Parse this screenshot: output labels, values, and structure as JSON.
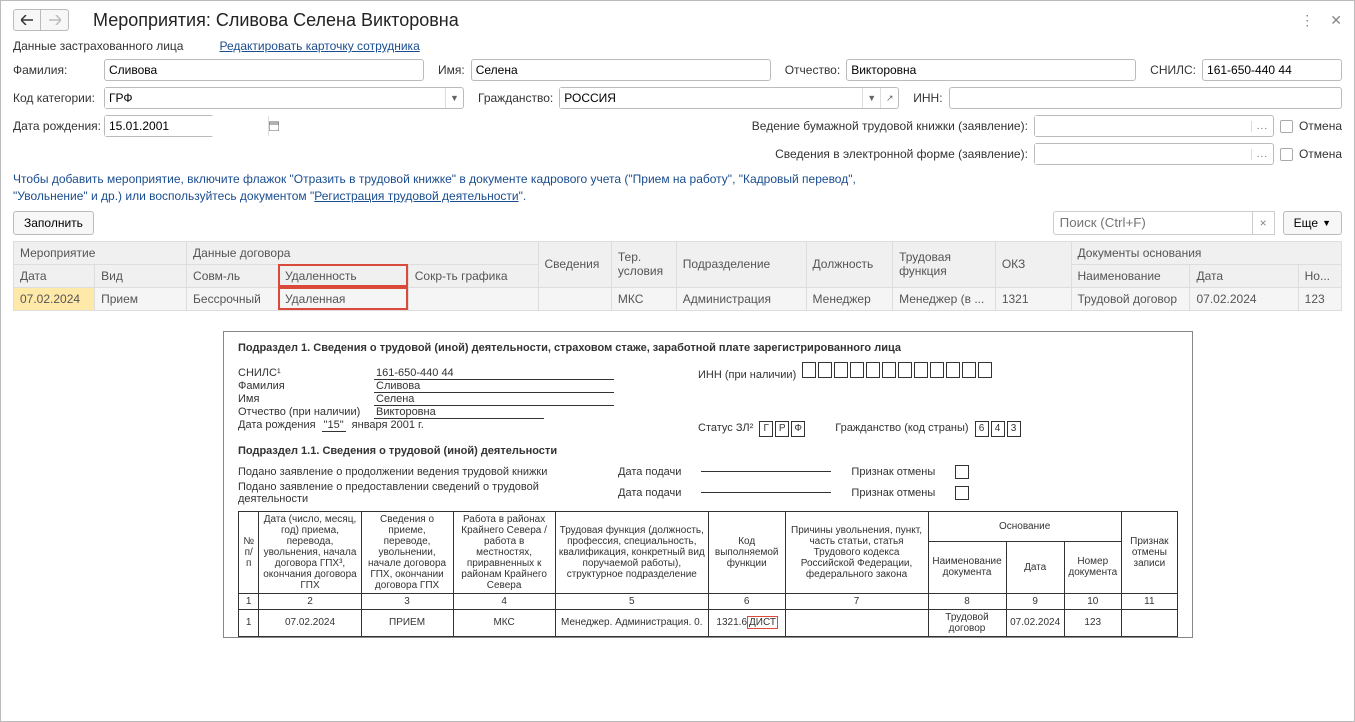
{
  "header": {
    "title": "Мероприятия: Сливова Селена Викторовна"
  },
  "insured": {
    "section_label": "Данные застрахованного лица",
    "edit_link": "Редактировать карточку сотрудника",
    "surname_label": "Фамилия:",
    "surname": "Сливова",
    "name_label": "Имя:",
    "name": "Селена",
    "patronymic_label": "Отчество:",
    "patronymic": "Викторовна",
    "snils_label": "СНИЛС:",
    "snils": "161-650-440 44",
    "category_label": "Код категории:",
    "category": "ГРФ",
    "citizenship_label": "Гражданство:",
    "citizenship": "РОССИЯ",
    "inn_label": "ИНН:",
    "inn": "",
    "dob_label": "Дата рождения:",
    "dob": "15.01.2001",
    "paper_book_label": "Ведение бумажной трудовой книжки (заявление):",
    "paper_book_cancel": "Отмена",
    "electronic_label": "Сведения в электронной форме (заявление):",
    "electronic_cancel": "Отмена"
  },
  "hint": {
    "line1": "Чтобы добавить мероприятие, включите флажок \"Отразить в трудовой книжке\" в документе кадрового учета (\"Прием на работу\", \"Кадровый перевод\",",
    "line2_start": "\"Увольнение\" и др.) или воспользуйтесь документом \"",
    "line2_link": "Регистрация трудовой деятельности",
    "line2_end": "\"."
  },
  "toolbar": {
    "fill_btn": "Заполнить",
    "search_placeholder": "Поиск (Ctrl+F)",
    "more_btn": "Еще"
  },
  "grid": {
    "h_event": "Мероприятие",
    "h_contract": "Данные договора",
    "h_sved": "Сведения",
    "h_ter": "Тер. условия",
    "h_podr": "Подразделение",
    "h_dolzh": "Должность",
    "h_trud": "Трудовая функция",
    "h_okz": "ОКЗ",
    "h_docs": "Документы основания",
    "h_date": "Дата",
    "h_vid": "Вид",
    "h_sovm": "Совм-ль",
    "h_udal": "Удаленность",
    "h_sokr": "Сокр-ть графика",
    "h_naim": "Наименование",
    "h_ddate": "Дата",
    "h_no": "Но...",
    "row": {
      "date": "07.02.2024",
      "vid": "Прием",
      "sovm": "Бессрочный",
      "udal": "Удаленная",
      "sokr": "",
      "sved": "",
      "ter": "МКС",
      "podr": "Администрация",
      "dolzh": "Менеджер",
      "trud": "Менеджер (в ...",
      "okz": "1321",
      "naim": "Трудовой договор",
      "ddate": "07.02.2024",
      "no": "123"
    }
  },
  "report": {
    "title": "Подраздел 1. Сведения о трудовой (иной) деятельности, страховом стаже, заработной плате зарегистрированного лица",
    "snils_label": "СНИЛС¹",
    "snils": "161-650-440 44",
    "inn_label": "ИНН (при наличии)",
    "surname_label": "Фамилия",
    "surname": "Сливова",
    "name_label": "Имя",
    "name": "Селена",
    "patronymic_label": "Отчество (при наличии)",
    "patronymic": "Викторовна",
    "dob_label_pre": "Дата рождения ",
    "dob_day_q": "\"15\"",
    "dob_rest": " января 2001 г.",
    "status_label": "Статус ЗЛ²",
    "status_g": "Г",
    "status_r": "Р",
    "status_f": "Ф",
    "citizenship_label": "Гражданство (код страны)",
    "cz_6": "6",
    "cz_4": "4",
    "cz_3": "3",
    "subtitle": "Подраздел 1.1. Сведения о трудовой (иной) деятельности",
    "cont_paper": "Подано заявление о продолжении ведения трудовой книжки",
    "electronic_info": "Подано заявление о предоставлении сведений о трудовой деятельности",
    "date_submit": "Дата подачи",
    "cancel_flag": "Признак отмены",
    "th_np": "№ п/п",
    "th_date": "Дата (число, месяц, год) приема, перевода, увольнения, начала договора ГПХ³, окончания договора ГПХ",
    "th_sved": "Сведения о приеме, переводе, увольнении, начале договора ГПХ, окончании договора ГПХ",
    "th_north": "Работа в районах Крайнего Севера / работа в местностях, приравненных к районам Крайнего Севера",
    "th_func": "Трудовая функция (должность, профессия, специальность, квалификация, конкретный вид поручаемой работы), структурное подразделение",
    "th_code": "Код выполняемой функции",
    "th_reason": "Причины увольнения, пункт, часть статьи, статья Трудового кодекса Российской Федерации, федерального закона",
    "th_basis": "Основание",
    "th_cancelflag": "Признак отмены записи",
    "th_docname": "Наименование документа",
    "th_docdate": "Дата",
    "th_docnum": "Номер документа",
    "c1": "1",
    "c2": "2",
    "c3": "3",
    "c4": "4",
    "c5": "5",
    "c6": "6",
    "c7": "7",
    "c8": "8",
    "c9": "9",
    "c10": "10",
    "c11": "11",
    "r_np": "1",
    "r_date": "07.02.2024",
    "r_sved": "ПРИЕМ",
    "r_north": "МКС",
    "r_func": "Менеджер. Администрация. 0.",
    "r_code_num": "1321.6",
    "r_code_dist": "ДИСТ",
    "r_docname": "Трудовой договор",
    "r_docdate": "07.02.2024",
    "r_docnum": "123"
  }
}
